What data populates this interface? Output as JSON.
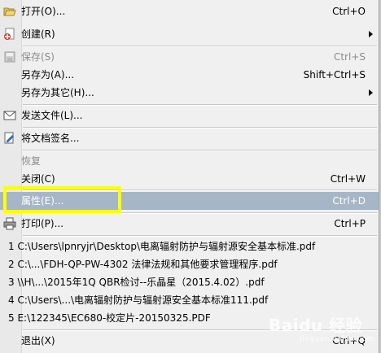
{
  "menu": {
    "items": [
      {
        "label": "打开(O)...",
        "shortcut": "Ctrl+O",
        "icon": "open-folder-icon",
        "disabled": false,
        "submenu": false
      },
      {
        "label": "创建(R)",
        "shortcut": "",
        "icon": "create-pdf-icon",
        "disabled": false,
        "submenu": true
      },
      {
        "label": "保存(S)",
        "shortcut": "Ctrl+S",
        "icon": "save-icon",
        "disabled": true,
        "submenu": false
      },
      {
        "label": "另存为(A)...",
        "shortcut": "Shift+Ctrl+S",
        "icon": "",
        "disabled": false,
        "submenu": false
      },
      {
        "label": "另存为其它(H)...",
        "shortcut": "",
        "icon": "",
        "disabled": false,
        "submenu": true
      },
      {
        "label": "发送文件(L)...",
        "shortcut": "",
        "icon": "envelope-icon",
        "disabled": false,
        "submenu": false
      },
      {
        "label": "将文档签名...",
        "shortcut": "",
        "icon": "sign-document-icon",
        "disabled": false,
        "submenu": false
      },
      {
        "label": "恢复",
        "shortcut": "",
        "icon": "",
        "disabled": true,
        "submenu": false
      },
      {
        "label": "关闭(C)",
        "shortcut": "Ctrl+W",
        "icon": "",
        "disabled": false,
        "submenu": false
      },
      {
        "label": "属性(E)...",
        "shortcut": "Ctrl+D",
        "icon": "",
        "disabled": false,
        "submenu": false,
        "highlighted": true
      },
      {
        "label": "打印(P)...",
        "shortcut": "Ctrl+P",
        "icon": "printer-icon",
        "disabled": false,
        "submenu": false
      }
    ],
    "recent_files": [
      "1 C:\\Users\\lpnryjr\\Desktop\\电离辐射防护与辐射源安全基本标准.pdf",
      "2 C:\\...\\FDH-QP-PW-4302 法律法规和其他要求管理程序.pdf",
      "3 \\\\H\\...\\2015年1Q QBR检讨--乐晶星（2015.4.02）.pdf",
      "4 C:\\Users\\...\\电离辐射防护与辐射源安全基本标准111.pdf",
      "5 E:\\122345\\EC680-校定片-20150325.PDF"
    ],
    "exit": {
      "label": "退出(X)",
      "shortcut": "Ctrl+Q"
    }
  },
  "watermark": {
    "text": "Baidu 经验",
    "sub": "jingyan.baidu.com"
  },
  "colors": {
    "menu_bg": "#f0f0f0",
    "highlight": "#a6b6c7",
    "annotation": "#ffff00",
    "disabled_text": "#8c8c8c"
  }
}
